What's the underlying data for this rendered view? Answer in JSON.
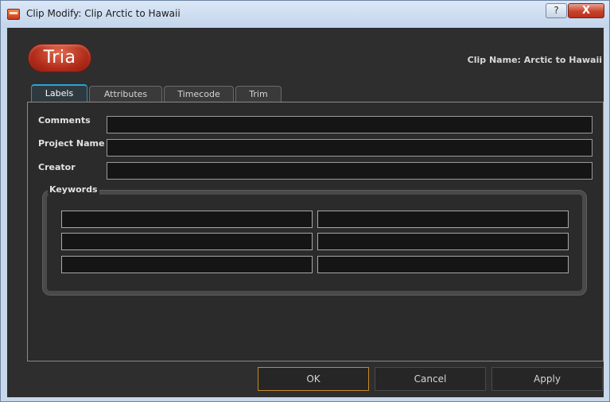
{
  "window": {
    "title": "Clip Modify: Clip Arctic to Hawaii",
    "help_glyph": "?",
    "close_glyph": "X"
  },
  "header": {
    "logo_text": "Tria",
    "clip_name": "Clip Name: Arctic to Hawaii"
  },
  "tabs": [
    {
      "label": "Labels",
      "active": true
    },
    {
      "label": "Attributes",
      "active": false
    },
    {
      "label": "Timecode",
      "active": false
    },
    {
      "label": "Trim",
      "active": false
    }
  ],
  "fields": {
    "comments_label": "Comments",
    "comments_value": "",
    "project_name_label": "Project Name",
    "project_name_value": "",
    "creator_label": "Creator",
    "creator_value": ""
  },
  "keywords": {
    "label": "Keywords",
    "values": [
      "",
      "",
      "",
      "",
      "",
      ""
    ]
  },
  "buttons": {
    "ok": "OK",
    "cancel": "Cancel",
    "apply": "Apply"
  },
  "colors": {
    "accent_tab": "#2aa5d4",
    "default_button_border": "#c88a28",
    "close_button": "#c7432b",
    "logo": "#b22c1a"
  }
}
